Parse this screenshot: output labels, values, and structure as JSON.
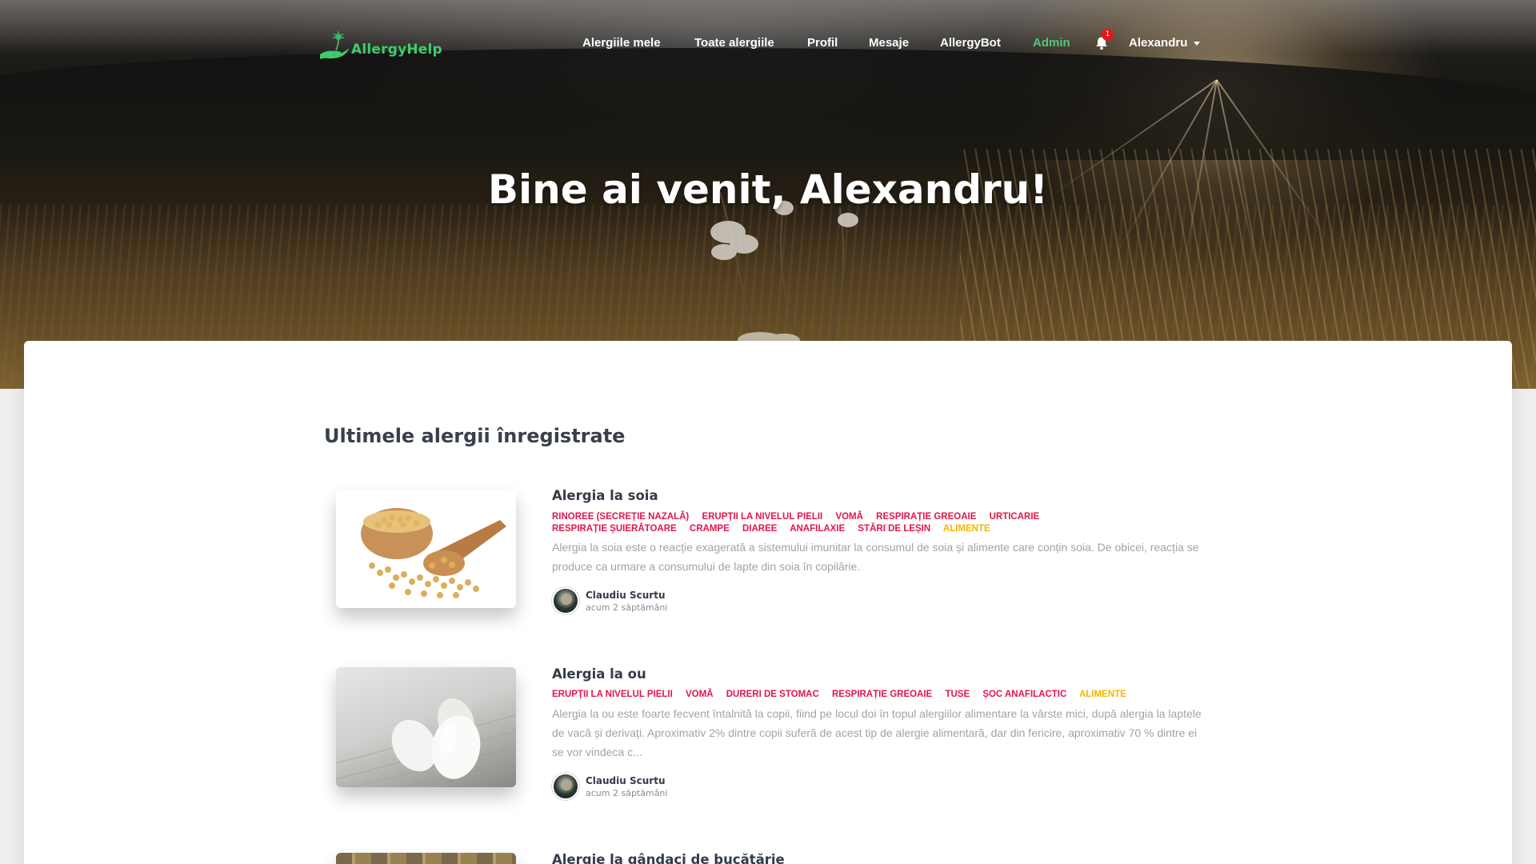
{
  "brand": {
    "name": "AllergyHelp"
  },
  "nav": {
    "items": [
      {
        "label": "Alergiile mele"
      },
      {
        "label": "Toate alergiile"
      },
      {
        "label": "Profil"
      },
      {
        "label": "Mesaje"
      },
      {
        "label": "AllergyBot"
      },
      {
        "label": "Admin",
        "active": true
      }
    ],
    "notifications_count": "1",
    "user_name": "Alexandru"
  },
  "hero": {
    "title": "Bine ai venit, Alexandru!"
  },
  "section": {
    "title": "Ultimele alergii înregistrate"
  },
  "allergies": [
    {
      "title": "Alergia la soia",
      "image_icon": "soybeans-image",
      "symptoms": [
        "Rinoree (secreție nazală)",
        "Erupții la nivelul pielii",
        "Vomă",
        "Respirație greoaie",
        "Urticarie",
        "Respirație șuierătoare",
        "Crampe",
        "Diaree",
        "Anafilaxie",
        "Stări de leșin"
      ],
      "category": "Alimente",
      "excerpt": "Alergia la soia este o reacție exagerată a sistemului imunitar la consumul de soia și alimente care conțin soia. De obicei, reacția se produce ca urmare a consumului de lapte din soia în copilărie.",
      "author": "Claudiu Scurtu",
      "time": "acum 2 săptămâni"
    },
    {
      "title": "Alergia la ou",
      "image_icon": "eggs-image",
      "symptoms": [
        "Erupții la nivelul pielii",
        "Vomă",
        "Dureri de stomac",
        "Respirație greoaie",
        "Tuse",
        "Șoc anafilactic"
      ],
      "category": "Alimente",
      "excerpt": "Alergia la ou este foarte fecvent întalnită la copii, fiind pe locul doi în topul alergiilor alimentare la vârste mici, după alergia la laptele de vacă și derivați. Aproximativ 2% dintre copii suferă de acest tip de alergie alimentară, dar din fericire, aproximativ 70 % dintre ei se vor vindeca c...",
      "author": "Claudiu Scurtu",
      "time": "acum 2 săptămâni"
    },
    {
      "title": "Alergie la gândaci de bucătărie",
      "image_icon": "cockroach-image"
    }
  ],
  "colors": {
    "accent_green": "#4fc876",
    "symptom_tag": "#e2164a",
    "category_tag": "#f2b600",
    "badge_red": "#e3171b"
  }
}
